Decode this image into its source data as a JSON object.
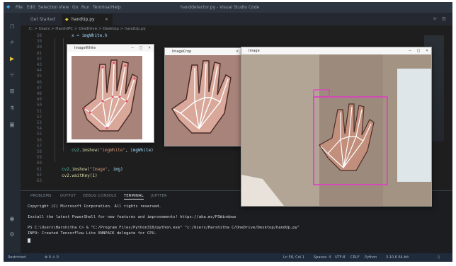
{
  "titlebar": {
    "menu": [
      "File",
      "Edit",
      "Selection",
      "View",
      "Go",
      "Run",
      "Terminal",
      "Help"
    ],
    "title": "handdetector.py - Visual Studio Code"
  },
  "tabs": [
    {
      "label": "Get Started"
    },
    {
      "label": "handUp.py"
    }
  ],
  "breadcrumb": "C: > Users > HarshiPC > OneDrive > Desktop > handUp.py",
  "editor": {
    "line_numbers": [
      "38",
      "39",
      "40",
      "41",
      "42",
      "43",
      "44",
      "45",
      "46",
      "47",
      "48",
      "49",
      "50",
      "51",
      "52",
      "53",
      "54",
      "55",
      "56",
      "57",
      "58",
      "59",
      "60",
      "61",
      "62",
      "63"
    ],
    "top_line": "x = imgWhite.h"
  },
  "code": {
    "imshow_white": "imgWhite",
    "imshow_image": "Image",
    "wait_call": "cv2.waitKey(1)"
  },
  "windows": {
    "white_title": "ImageWhite",
    "crop_title": "ImageCrop",
    "image_title": "Image"
  },
  "panel": {
    "tabs": [
      "PROBLEMS",
      "OUTPUT",
      "DEBUG CONSOLE",
      "TERMINAL",
      "JUPYTER"
    ],
    "active_tab": "TERMINAL",
    "terminal": {
      "copyright": "Copyright (C) Microsoft Corporation. All rights reserved.",
      "install_line": "Install the latest PowerShell for new features and improvements! https://aka.ms/PSWindows",
      "ps_line": "PS C:\\Users\\Harshitha C> & \"C:/Program Files/Python310/python.exe\" \"c:/Users/Harshitha C/OneDrive/Desktop/handUp.py\"",
      "info_line": "INFO: Created TensorFlow Lite XNNPACK delegate for CPU."
    }
  },
  "statusbar": {
    "left": [
      "Restricted",
      "⊗ 0 ⚠ 0"
    ],
    "right": [
      "Ln 58, Col 1",
      "Spaces: 4",
      "UTF-8",
      "CRLF",
      "Python",
      "3.10.6 64-bit"
    ]
  },
  "colors": {
    "bbox": "#e03ac4",
    "skeleton": "#ffffff",
    "landmark": "#e0556a"
  }
}
